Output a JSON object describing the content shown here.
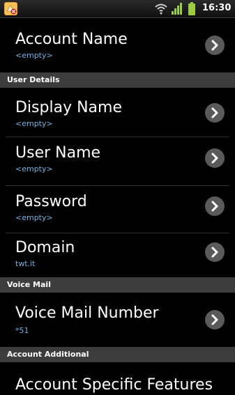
{
  "status_bar": {
    "time": "16:30",
    "icons": [
      "notification-icon",
      "wifi-icon",
      "signal-icon",
      "battery-icon"
    ]
  },
  "settings": {
    "account_name": {
      "title": "Account Name",
      "value": "<empty>"
    },
    "user_details_header": "User Details",
    "display_name": {
      "title": "Display Name",
      "value": "<empty>"
    },
    "user_name": {
      "title": "User Name",
      "value": "<empty>"
    },
    "password": {
      "title": "Password",
      "value": "<empty>"
    },
    "domain": {
      "title": "Domain",
      "value": "twt.it"
    },
    "voice_mail_header": "Voice Mail",
    "voice_mail_number": {
      "title": "Voice Mail Number",
      "value": "*51"
    },
    "account_additional_header": "Account Additional",
    "account_specific_features": {
      "title": "Account Specific Features"
    }
  },
  "colors": {
    "background": "#000000",
    "section_header": "#3d3d3d",
    "subtitle": "#6fb3e0",
    "chevron_circle": "#5a5a5a"
  }
}
